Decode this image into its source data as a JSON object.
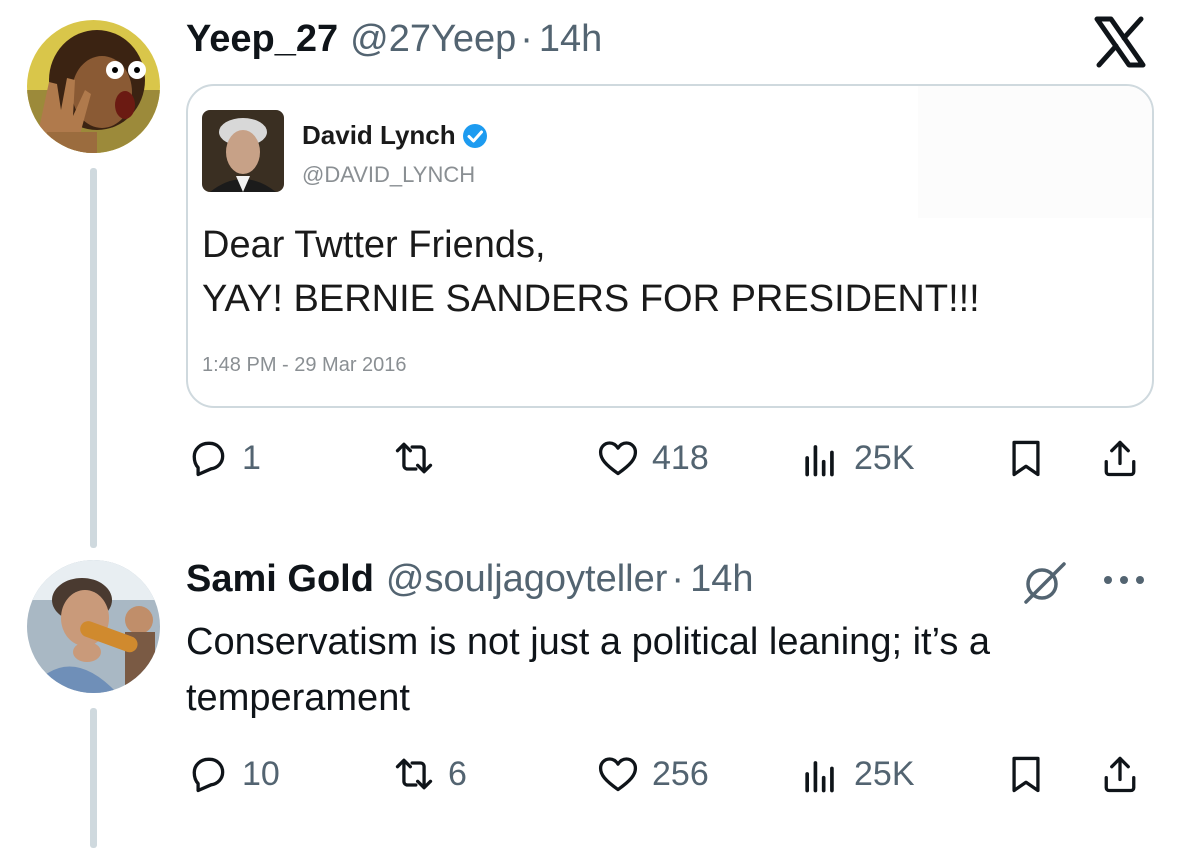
{
  "post": {
    "display_name": "Yeep_27",
    "handle": "@27Yeep",
    "separator": "·",
    "time": "14h",
    "quote": {
      "display_name": "David Lynch",
      "handle": "@DAVID_LYNCH",
      "line1": "Dear Twtter Friends,",
      "line2": "YAY! BERNIE SANDERS FOR PRESIDENT!!!",
      "timestamp": "1:48 PM - 29 Mar 2016"
    },
    "stats": {
      "replies": "1",
      "reposts": "",
      "likes": "418",
      "views": "25K"
    }
  },
  "reply": {
    "display_name": "Sami Gold",
    "handle": "@souljagoyteller",
    "separator": "·",
    "time": "14h",
    "text": "Conservatism is not just a political leaning; it’s a temperament",
    "stats": {
      "replies": "10",
      "reposts": "6",
      "likes": "256",
      "views": "25K"
    }
  },
  "icons": {
    "brand": "x-logo-icon",
    "verified": "verified-badge-icon",
    "reply": "reply-icon",
    "repost": "repost-icon",
    "like": "like-icon",
    "views": "views-icon",
    "bookmark": "bookmark-icon",
    "share": "share-icon",
    "grok": "grok-icon",
    "more": "more-icon"
  },
  "colors": {
    "text": "#0f1419",
    "secondary": "#536471",
    "verified": "#1d9bf0",
    "line": "#cfd9de"
  }
}
